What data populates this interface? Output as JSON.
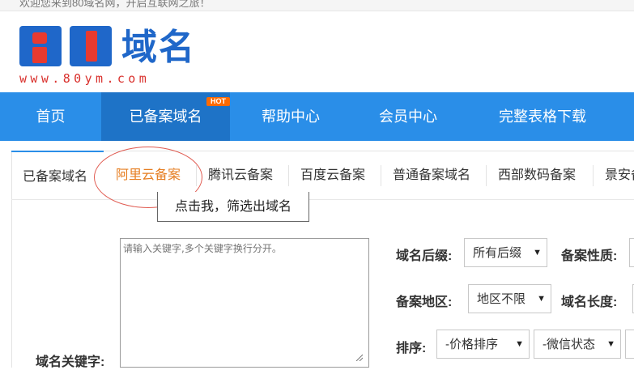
{
  "topbar": {
    "text": "欢迎您来到80域名网，开启互联网之旅！"
  },
  "logo": {
    "cn_text": "域名",
    "url_text": "www.80ym.com"
  },
  "nav": {
    "items": [
      {
        "label": "首页"
      },
      {
        "label": "已备案域名",
        "badge": "HOT"
      },
      {
        "label": "帮助中心"
      },
      {
        "label": "会员中心"
      },
      {
        "label": "完整表格下载"
      }
    ]
  },
  "tabs": {
    "items": [
      {
        "label": "已备案域名"
      },
      {
        "label": "阿里云备案"
      },
      {
        "label": "腾讯云备案"
      },
      {
        "label": "百度云备案"
      },
      {
        "label": "普通备案域名"
      },
      {
        "label": "西部数码备案"
      },
      {
        "label": "景安备"
      }
    ],
    "active_index": 1
  },
  "tooltip": {
    "text": "点击我，筛选出域名"
  },
  "form": {
    "keyword_label": "域名关键字:",
    "keyword_placeholder": "请输入关键字,多个关键字换行分开。",
    "suffix_label": "域名后缀:",
    "suffix_value": "所有后缀",
    "record_nature_label": "备案性质:",
    "region_label": "备案地区:",
    "region_value": "地区不限",
    "length_label": "域名长度:",
    "sort_label": "排序:",
    "price_sort_value": "-价格排序",
    "wechat_value": "-微信状态"
  },
  "colors": {
    "nav_bg": "#2a8ee8",
    "nav_active": "#1e73c7",
    "accent": "#e67e22",
    "hot": "#ff6a00",
    "logo_blue": "#1f67c9",
    "logo_red": "#e83a2f"
  }
}
